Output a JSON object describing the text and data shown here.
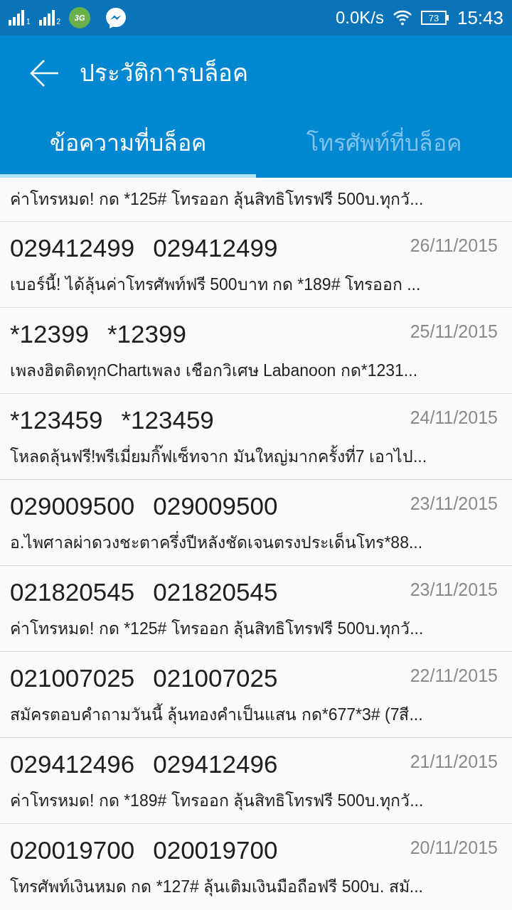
{
  "status_bar": {
    "sim_labels": [
      "1",
      "2"
    ],
    "network_label": "3G",
    "speed": "0.0K/s",
    "battery": "73",
    "time": "15:43"
  },
  "app_bar": {
    "title": "ประวัติการบล็อค"
  },
  "tabs": [
    {
      "label": "ข้อความที่บล็อค",
      "selected": true
    },
    {
      "label": "โทรศัพท์ที่บล็อค",
      "selected": false
    }
  ],
  "messages": [
    {
      "preview": "ค่าโทรหมด! กด *125# โทรออก ลุ้นสิทธิโทรฟรี 500บ.ทุกวั..."
    },
    {
      "sender": "029412499",
      "number": "029412499",
      "date": "26/11/2015",
      "preview": "เบอร์นี้! ได้ลุ้นค่าโทรศัพท์ฟรี 500บาท กด *189# โทรออก ..."
    },
    {
      "sender": "*12399",
      "number": "*12399",
      "date": "25/11/2015",
      "preview": "เพลงฮิตติดทุกChartเพลง เชือกวิเศษ Labanoon กด*1231..."
    },
    {
      "sender": "*123459",
      "number": "*123459",
      "date": "24/11/2015",
      "preview": "โหลดลุ้นฟรี!พรีเมี่ยมกิ๊ฟเซ็ทจาก มันใหญ่มากครั้งที่7 เอาไป..."
    },
    {
      "sender": "029009500",
      "number": "029009500",
      "date": "23/11/2015",
      "preview": "อ.ไพศาลผ่าดวงชะตาครึ่งปีหลังชัดเจนตรงประเด็นโทร*88..."
    },
    {
      "sender": "021820545",
      "number": "021820545",
      "date": "23/11/2015",
      "preview": "ค่าโทรหมด! กด *125# โทรออก ลุ้นสิทธิโทรฟรี 500บ.ทุกวั..."
    },
    {
      "sender": "021007025",
      "number": "021007025",
      "date": "22/11/2015",
      "preview": "สมัครตอบคำถามวันนี้ ลุ้นทองคำเป็นแสน กด*677*3# (7สี..."
    },
    {
      "sender": "029412496",
      "number": "029412496",
      "date": "21/11/2015",
      "preview": "ค่าโทรหมด! กด *189# โทรออก ลุ้นสิทธิโทรฟรี 500บ.ทุกวั..."
    },
    {
      "sender": "020019700",
      "number": "020019700",
      "date": "20/11/2015",
      "preview": "โทรศัพท์เงินหมด กด *127# ลุ้นเติมเงินมือถือฟรี 500บ. สมั..."
    }
  ]
}
